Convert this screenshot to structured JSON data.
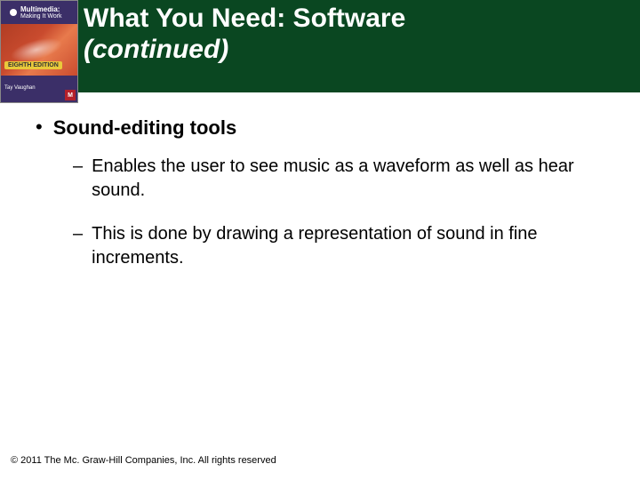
{
  "header": {
    "title_line1": "What You Need: Software",
    "title_line2": "(continued)"
  },
  "book": {
    "title": "Multimedia:",
    "subtitle": "Making It Work",
    "badge": "EIGHTH EDITION",
    "author": "Tay Vaughan",
    "logo": "M"
  },
  "content": {
    "bullet": "Sound-editing tools",
    "subs": [
      "Enables the user to see music as a waveform as well as hear sound.",
      "This is done by drawing a representation of sound in fine increments."
    ]
  },
  "footer": "© 2011 The Mc. Graw-Hill Companies, Inc. All rights reserved"
}
